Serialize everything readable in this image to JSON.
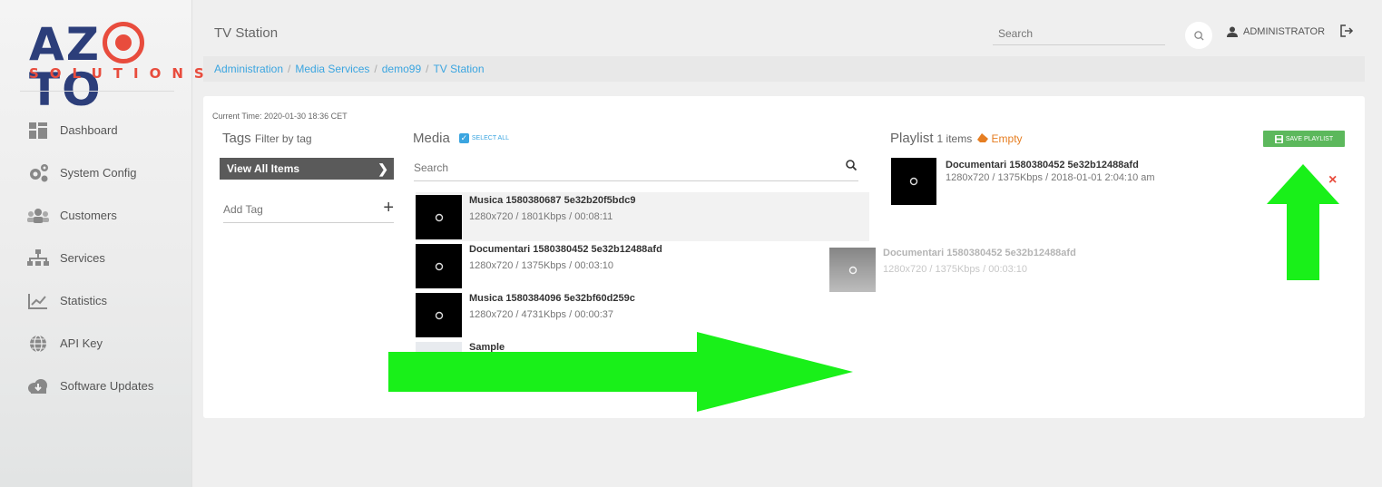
{
  "brand": {
    "name": "AZOTO",
    "tagline": "SOLUTIONS"
  },
  "sidebar": {
    "items": [
      {
        "label": "Dashboard",
        "icon": "dashboard-icon"
      },
      {
        "label": "System Config",
        "icon": "gears-icon"
      },
      {
        "label": "Customers",
        "icon": "users-icon"
      },
      {
        "label": "Services",
        "icon": "sitemap-icon"
      },
      {
        "label": "Statistics",
        "icon": "chart-icon"
      },
      {
        "label": "API Key",
        "icon": "globe-icon"
      },
      {
        "label": "Software Updates",
        "icon": "cloud-download-icon"
      }
    ]
  },
  "header": {
    "title": "TV Station",
    "search_placeholder": "Search",
    "user": "ADMINISTRATOR"
  },
  "breadcrumb": [
    "Administration",
    "Media Services",
    "demo99",
    "TV Station"
  ],
  "main": {
    "current_time": "Current Time: 2020-01-30 18:36 CET",
    "tags": {
      "title": "Tags",
      "subtitle": "Filter by tag",
      "view_all": "View All Items",
      "add_placeholder": "Add Tag",
      "add_symbol": "+"
    },
    "media": {
      "title": "Media",
      "select_all": "SELECT ALL",
      "search_placeholder": "Search",
      "items": [
        {
          "title": "Musica 1580380687 5e32b20f5bdc9",
          "meta": "1280x720 / 1801Kbps / 00:08:11"
        },
        {
          "title": "Documentari 1580380452 5e32b12488afd",
          "meta": "1280x720 / 1375Kbps / 00:03:10"
        },
        {
          "title": "Musica 1580384096 5e32bf60d259c",
          "meta": "1280x720 / 4731Kbps / 00:00:37"
        },
        {
          "title": "Sample",
          "meta": ""
        }
      ],
      "dragging": {
        "title": "Documentari 1580380452 5e32b12488afd",
        "meta": "1280x720 / 1375Kbps / 00:03:10"
      }
    },
    "playlist": {
      "title": "Playlist",
      "count": "1 items",
      "empty_label": "Empty",
      "save_label": "SAVE PLAYLIST",
      "items": [
        {
          "title": "Documentari 1580380452 5e32b12488afd",
          "meta": "1280x720 / 1375Kbps / 2018-01-01 2:04:10 am",
          "remove": "×"
        }
      ]
    }
  },
  "colors": {
    "accent_blue": "#3ba5e0",
    "brand_navy": "#2c3e7a",
    "brand_red": "#e84c3d",
    "save_green": "#5cb85c",
    "empty_orange": "#e67e22",
    "annotation_arrow": "#19f019"
  }
}
